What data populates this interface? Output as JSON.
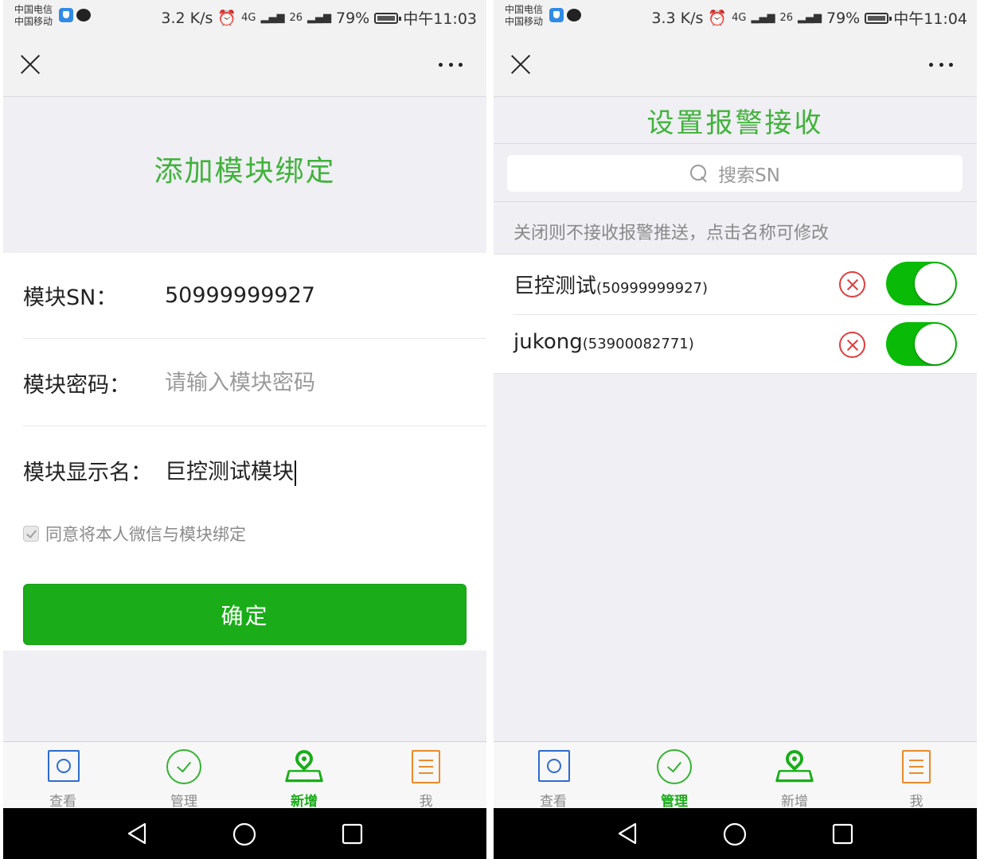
{
  "status_bar_left": {
    "carrier_1": "中国电信",
    "carrier_2": "中国移动",
    "speed": "3.2 K/s",
    "network_1": "4G",
    "network_2": "26",
    "battery": "79%",
    "time": "中午11:03"
  },
  "status_bar_right": {
    "carrier_1": "中国电信",
    "carrier_2": "中国移动",
    "speed": "3.3 K/s",
    "network_1": "4G",
    "network_2": "26",
    "battery": "79%",
    "time": "中午11:04"
  },
  "add_binding": {
    "title": "添加模块绑定",
    "sn_label": "模块SN：",
    "sn_value": "50999999927",
    "password_label": "模块密码：",
    "password_placeholder": "请输入模块密码",
    "display_name_label": "模块显示名：",
    "display_name_value": "巨控测试模块",
    "agree_label": "同意将本人微信与模块绑定",
    "confirm_label": "确定"
  },
  "alarm_settings": {
    "title": "设置报警接收",
    "search_placeholder": "搜索SN",
    "hint": "关闭则不接收报警推送，点击名称可修改",
    "items": [
      {
        "name": "巨控测试",
        "sn": "(50999999927)",
        "enabled": true
      },
      {
        "name": "jukong",
        "sn": "(53900082771)",
        "enabled": true
      }
    ]
  },
  "tabs": [
    {
      "label": "查看",
      "icon": "view-icon"
    },
    {
      "label": "管理",
      "icon": "manage-icon"
    },
    {
      "label": "新增",
      "icon": "add-location-icon"
    },
    {
      "label": "我",
      "icon": "profile-icon"
    }
  ],
  "active_tab_left": "新增",
  "active_tab_right": "管理",
  "colors": {
    "accent_green": "#1aad19",
    "title_green": "#41b23a",
    "toggle_on": "#09bb07",
    "delete_red": "#e03d3d"
  }
}
